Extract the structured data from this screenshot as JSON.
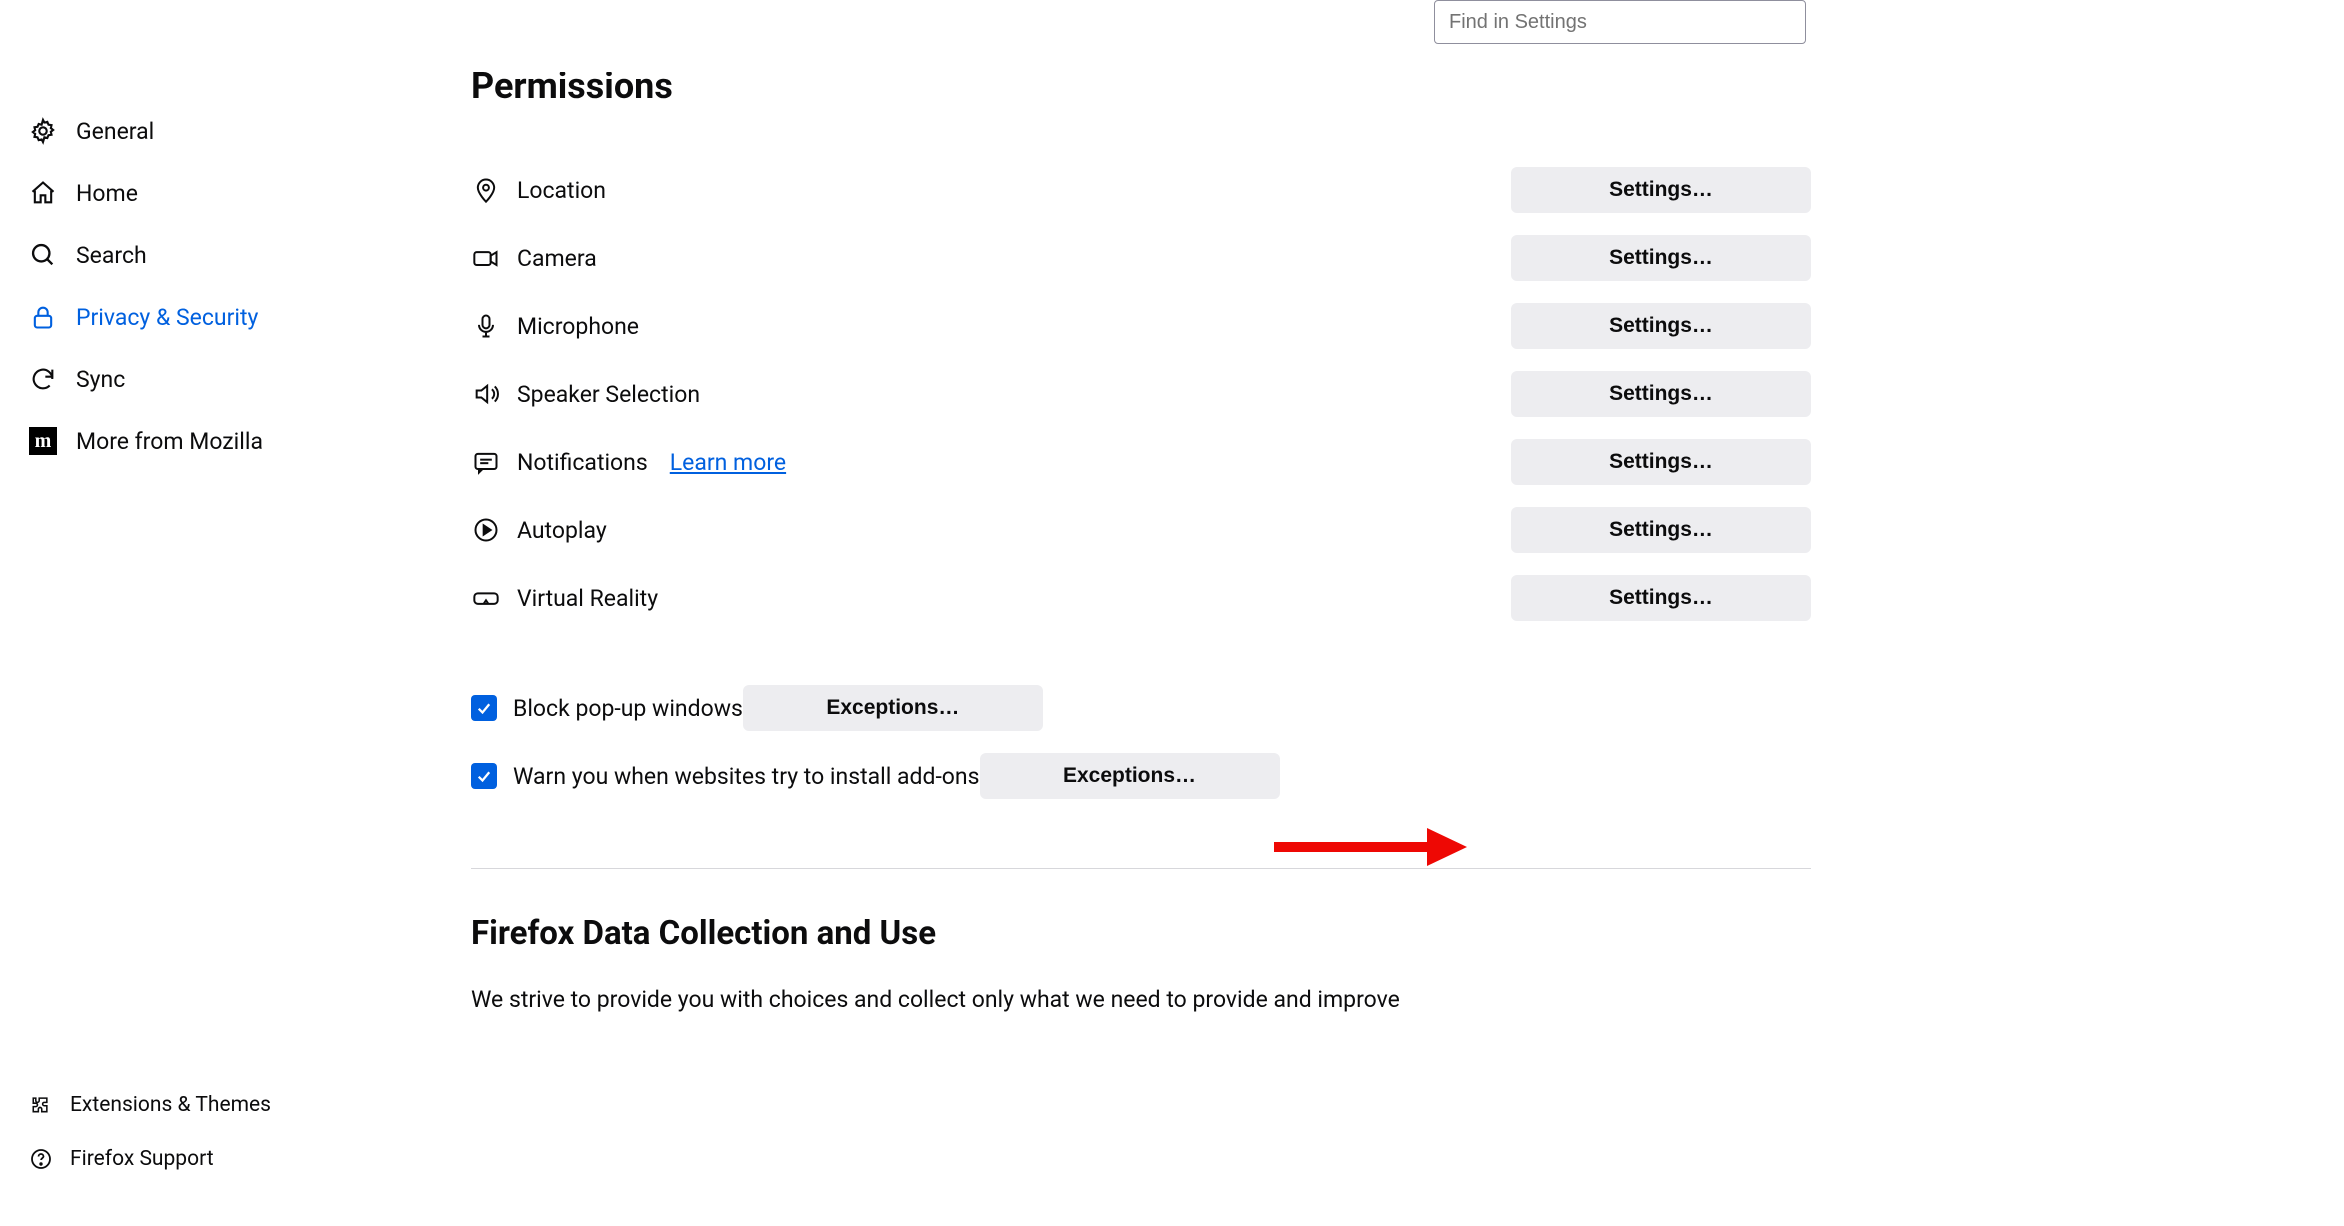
{
  "search": {
    "placeholder": "Find in Settings"
  },
  "sidebar": {
    "items": [
      {
        "label": "General"
      },
      {
        "label": "Home"
      },
      {
        "label": "Search"
      },
      {
        "label": "Privacy & Security"
      },
      {
        "label": "Sync"
      },
      {
        "label": "More from Mozilla"
      }
    ],
    "bottom": [
      {
        "label": "Extensions & Themes"
      },
      {
        "label": "Firefox Support"
      }
    ]
  },
  "permissions": {
    "heading": "Permissions",
    "rows": [
      {
        "label": "Location",
        "button": "Settings…"
      },
      {
        "label": "Camera",
        "button": "Settings…"
      },
      {
        "label": "Microphone",
        "button": "Settings…"
      },
      {
        "label": "Speaker Selection",
        "button": "Settings…"
      },
      {
        "label": "Notifications",
        "button": "Settings…",
        "learn_more": "Learn more"
      },
      {
        "label": "Autoplay",
        "button": "Settings…"
      },
      {
        "label": "Virtual Reality",
        "button": "Settings…"
      }
    ],
    "checkboxes": [
      {
        "label": "Block pop-up windows",
        "checked": true,
        "button": "Exceptions…"
      },
      {
        "label": "Warn you when websites try to install add-ons",
        "checked": true,
        "button": "Exceptions…"
      }
    ]
  },
  "data_collection": {
    "heading": "Firefox Data Collection and Use",
    "body": "We strive to provide you with choices and collect only what we need to provide and improve"
  }
}
